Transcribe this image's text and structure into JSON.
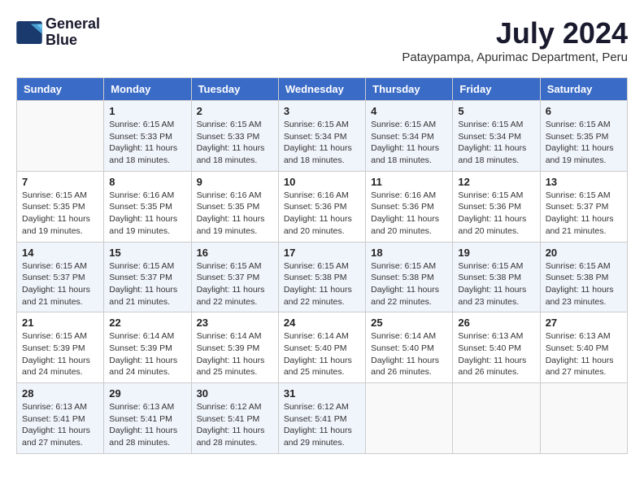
{
  "header": {
    "logo_line1": "General",
    "logo_line2": "Blue",
    "month_title": "July 2024",
    "subtitle": "Pataypampa, Apurimac Department, Peru"
  },
  "columns": [
    "Sunday",
    "Monday",
    "Tuesday",
    "Wednesday",
    "Thursday",
    "Friday",
    "Saturday"
  ],
  "weeks": [
    [
      {
        "day": "",
        "text": ""
      },
      {
        "day": "1",
        "text": "Sunrise: 6:15 AM\nSunset: 5:33 PM\nDaylight: 11 hours\nand 18 minutes."
      },
      {
        "day": "2",
        "text": "Sunrise: 6:15 AM\nSunset: 5:33 PM\nDaylight: 11 hours\nand 18 minutes."
      },
      {
        "day": "3",
        "text": "Sunrise: 6:15 AM\nSunset: 5:34 PM\nDaylight: 11 hours\nand 18 minutes."
      },
      {
        "day": "4",
        "text": "Sunrise: 6:15 AM\nSunset: 5:34 PM\nDaylight: 11 hours\nand 18 minutes."
      },
      {
        "day": "5",
        "text": "Sunrise: 6:15 AM\nSunset: 5:34 PM\nDaylight: 11 hours\nand 18 minutes."
      },
      {
        "day": "6",
        "text": "Sunrise: 6:15 AM\nSunset: 5:35 PM\nDaylight: 11 hours\nand 19 minutes."
      }
    ],
    [
      {
        "day": "7",
        "text": "Sunrise: 6:15 AM\nSunset: 5:35 PM\nDaylight: 11 hours\nand 19 minutes."
      },
      {
        "day": "8",
        "text": "Sunrise: 6:16 AM\nSunset: 5:35 PM\nDaylight: 11 hours\nand 19 minutes."
      },
      {
        "day": "9",
        "text": "Sunrise: 6:16 AM\nSunset: 5:35 PM\nDaylight: 11 hours\nand 19 minutes."
      },
      {
        "day": "10",
        "text": "Sunrise: 6:16 AM\nSunset: 5:36 PM\nDaylight: 11 hours\nand 20 minutes."
      },
      {
        "day": "11",
        "text": "Sunrise: 6:16 AM\nSunset: 5:36 PM\nDaylight: 11 hours\nand 20 minutes."
      },
      {
        "day": "12",
        "text": "Sunrise: 6:15 AM\nSunset: 5:36 PM\nDaylight: 11 hours\nand 20 minutes."
      },
      {
        "day": "13",
        "text": "Sunrise: 6:15 AM\nSunset: 5:37 PM\nDaylight: 11 hours\nand 21 minutes."
      }
    ],
    [
      {
        "day": "14",
        "text": "Sunrise: 6:15 AM\nSunset: 5:37 PM\nDaylight: 11 hours\nand 21 minutes."
      },
      {
        "day": "15",
        "text": "Sunrise: 6:15 AM\nSunset: 5:37 PM\nDaylight: 11 hours\nand 21 minutes."
      },
      {
        "day": "16",
        "text": "Sunrise: 6:15 AM\nSunset: 5:37 PM\nDaylight: 11 hours\nand 22 minutes."
      },
      {
        "day": "17",
        "text": "Sunrise: 6:15 AM\nSunset: 5:38 PM\nDaylight: 11 hours\nand 22 minutes."
      },
      {
        "day": "18",
        "text": "Sunrise: 6:15 AM\nSunset: 5:38 PM\nDaylight: 11 hours\nand 22 minutes."
      },
      {
        "day": "19",
        "text": "Sunrise: 6:15 AM\nSunset: 5:38 PM\nDaylight: 11 hours\nand 23 minutes."
      },
      {
        "day": "20",
        "text": "Sunrise: 6:15 AM\nSunset: 5:38 PM\nDaylight: 11 hours\nand 23 minutes."
      }
    ],
    [
      {
        "day": "21",
        "text": "Sunrise: 6:15 AM\nSunset: 5:39 PM\nDaylight: 11 hours\nand 24 minutes."
      },
      {
        "day": "22",
        "text": "Sunrise: 6:14 AM\nSunset: 5:39 PM\nDaylight: 11 hours\nand 24 minutes."
      },
      {
        "day": "23",
        "text": "Sunrise: 6:14 AM\nSunset: 5:39 PM\nDaylight: 11 hours\nand 25 minutes."
      },
      {
        "day": "24",
        "text": "Sunrise: 6:14 AM\nSunset: 5:40 PM\nDaylight: 11 hours\nand 25 minutes."
      },
      {
        "day": "25",
        "text": "Sunrise: 6:14 AM\nSunset: 5:40 PM\nDaylight: 11 hours\nand 26 minutes."
      },
      {
        "day": "26",
        "text": "Sunrise: 6:13 AM\nSunset: 5:40 PM\nDaylight: 11 hours\nand 26 minutes."
      },
      {
        "day": "27",
        "text": "Sunrise: 6:13 AM\nSunset: 5:40 PM\nDaylight: 11 hours\nand 27 minutes."
      }
    ],
    [
      {
        "day": "28",
        "text": "Sunrise: 6:13 AM\nSunset: 5:41 PM\nDaylight: 11 hours\nand 27 minutes."
      },
      {
        "day": "29",
        "text": "Sunrise: 6:13 AM\nSunset: 5:41 PM\nDaylight: 11 hours\nand 28 minutes."
      },
      {
        "day": "30",
        "text": "Sunrise: 6:12 AM\nSunset: 5:41 PM\nDaylight: 11 hours\nand 28 minutes."
      },
      {
        "day": "31",
        "text": "Sunrise: 6:12 AM\nSunset: 5:41 PM\nDaylight: 11 hours\nand 29 minutes."
      },
      {
        "day": "",
        "text": ""
      },
      {
        "day": "",
        "text": ""
      },
      {
        "day": "",
        "text": ""
      }
    ]
  ]
}
